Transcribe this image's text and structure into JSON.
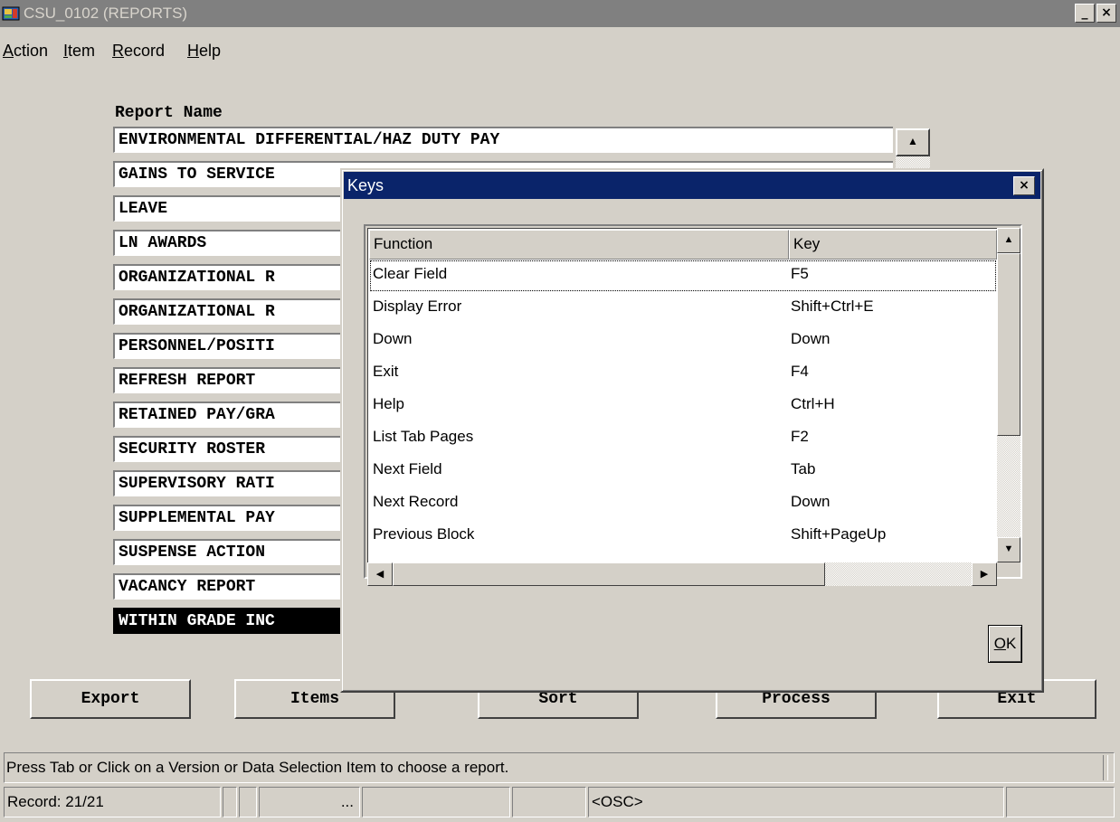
{
  "window": {
    "title": "CSU_0102 (REPORTS)",
    "minimize_label": "_",
    "close_label": "×"
  },
  "menu": [
    {
      "accel": "A",
      "rest": "ction"
    },
    {
      "accel": "I",
      "rest": "tem"
    },
    {
      "accel": "R",
      "rest": "ecord"
    },
    {
      "accel": "H",
      "rest": "elp"
    }
  ],
  "reports": {
    "header": "Report Name",
    "rows": [
      "ENVIRONMENTAL DIFFERENTIAL/HAZ DUTY PAY",
      "GAINS TO SERVICE",
      "LEAVE",
      "LN AWARDS",
      "ORGANIZATIONAL R",
      "ORGANIZATIONAL R",
      "PERSONNEL/POSITI",
      "REFRESH REPORT",
      "RETAINED PAY/GRA",
      "SECURITY ROSTER",
      "SUPERVISORY RATI",
      "SUPPLEMENTAL PAY",
      "SUSPENSE ACTION",
      "VACANCY REPORT",
      "WITHIN GRADE INC"
    ],
    "selected_row": "WITHIN GRADE INC"
  },
  "buttons": {
    "export": "Export",
    "items": "Items",
    "sort": "Sort",
    "process": "Process",
    "exit": "Exit"
  },
  "dialog": {
    "title": "Keys",
    "close_label": "×",
    "columns": {
      "function": "Function",
      "key": "Key"
    },
    "rows": [
      {
        "function": "Clear Field",
        "key": "F5"
      },
      {
        "function": "Display Error",
        "key": "Shift+Ctrl+E"
      },
      {
        "function": "Down",
        "key": "Down"
      },
      {
        "function": "Exit",
        "key": "F4"
      },
      {
        "function": "Help",
        "key": "Ctrl+H"
      },
      {
        "function": "List Tab Pages",
        "key": "F2"
      },
      {
        "function": "Next Field",
        "key": "Tab"
      },
      {
        "function": "Next Record",
        "key": "Down"
      },
      {
        "function": "Previous Block",
        "key": "Shift+PageUp"
      }
    ],
    "ok": {
      "accel": "O",
      "rest": "K"
    }
  },
  "status": {
    "message": "Press Tab or Click on a Version or Data Selection Item to choose a report.",
    "record": "Record: 21/21",
    "ellipsis": "...",
    "mode": "<OSC>"
  },
  "icons": {
    "up_arrow": "▲",
    "down_arrow": "▼",
    "left_arrow": "◀",
    "right_arrow": "▶"
  }
}
